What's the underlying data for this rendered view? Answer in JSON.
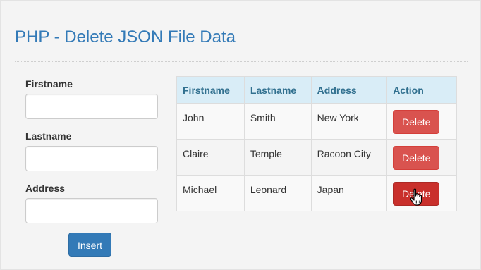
{
  "page": {
    "title": "PHP - Delete JSON File Data"
  },
  "form": {
    "firstname_label": "Firstname",
    "firstname_value": "",
    "lastname_label": "Lastname",
    "lastname_value": "",
    "address_label": "Address",
    "address_value": "",
    "insert_label": "Insert"
  },
  "table": {
    "headers": [
      "Firstname",
      "Lastname",
      "Address",
      "Action"
    ],
    "rows": [
      {
        "firstname": "John",
        "lastname": "Smith",
        "address": "New York",
        "action": "Delete"
      },
      {
        "firstname": "Claire",
        "lastname": "Temple",
        "address": "Racoon City",
        "action": "Delete"
      },
      {
        "firstname": "Michael",
        "lastname": "Leonard",
        "address": "Japan",
        "action": "Delete"
      }
    ]
  },
  "colors": {
    "title": "#337ab7",
    "header_bg": "#d9edf7",
    "header_text": "#31708f",
    "insert_button": "#337ab7",
    "delete_button": "#d9534f",
    "delete_button_active": "#c9302c"
  },
  "cursor": {
    "icon": "hand-pointer-icon",
    "hovering_row": 3
  }
}
